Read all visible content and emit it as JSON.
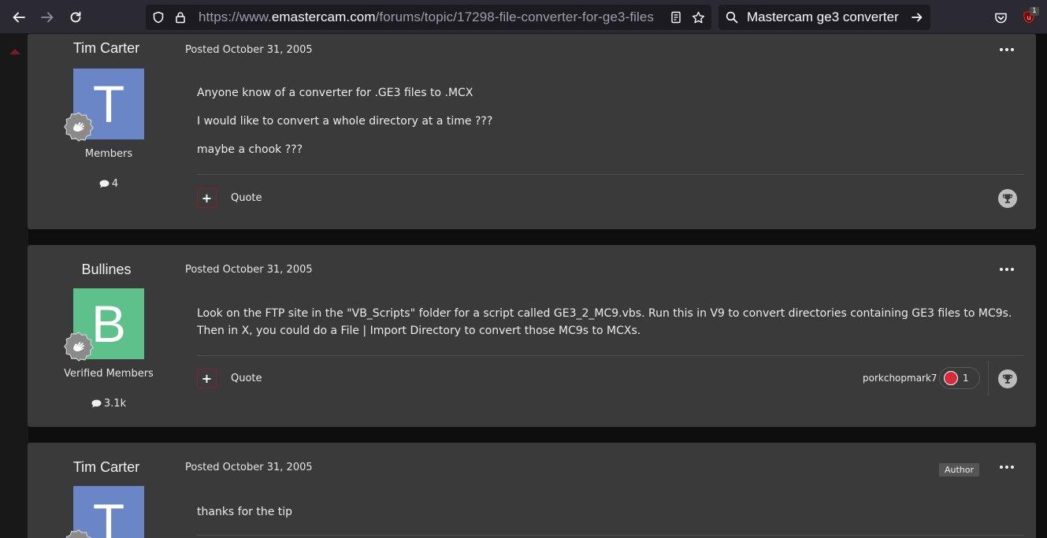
{
  "browser": {
    "url_prefix": "https://www.",
    "url_host": "emastercam.com",
    "url_path": "/forums/topic/17298-file-converter-for-ge3-files",
    "search_query": "Mastercam ge3 converter",
    "extension_badge": "1"
  },
  "posts": [
    {
      "author": "Tim Carter",
      "avatar_letter": "T",
      "avatar_color": "#6a86c7",
      "group": "Members",
      "post_count": "4",
      "posted": "Posted October 31, 2005",
      "paragraphs": [
        "Anyone know of a converter for .GE3 files to .MCX",
        "I would like to convert a whole directory at a time ???",
        "maybe a chook ???"
      ],
      "quote_label": "Quote"
    },
    {
      "author": "Bullines",
      "avatar_letter": "B",
      "avatar_color": "#5ec08a",
      "group": "Verified Members",
      "post_count": "3.1k",
      "posted": "Posted October 31, 2005",
      "paragraphs": [
        "Look on the FTP site in the \"VB_Scripts\" folder for a script called GE3_2_MC9.vbs. Run this in V9 to convert directories containing GE3 files to MC9s. Then in X, you could do a File | Import Directory to convert those MC9s to MCXs."
      ],
      "quote_label": "Quote",
      "reactor": "porkchopmark7",
      "reaction_count": "1"
    },
    {
      "author": "Tim Carter",
      "avatar_letter": "T",
      "avatar_color": "#6a86c7",
      "posted": "Posted October 31, 2005",
      "badge": "Author",
      "paragraphs": [
        "thanks for the tip"
      ]
    }
  ]
}
